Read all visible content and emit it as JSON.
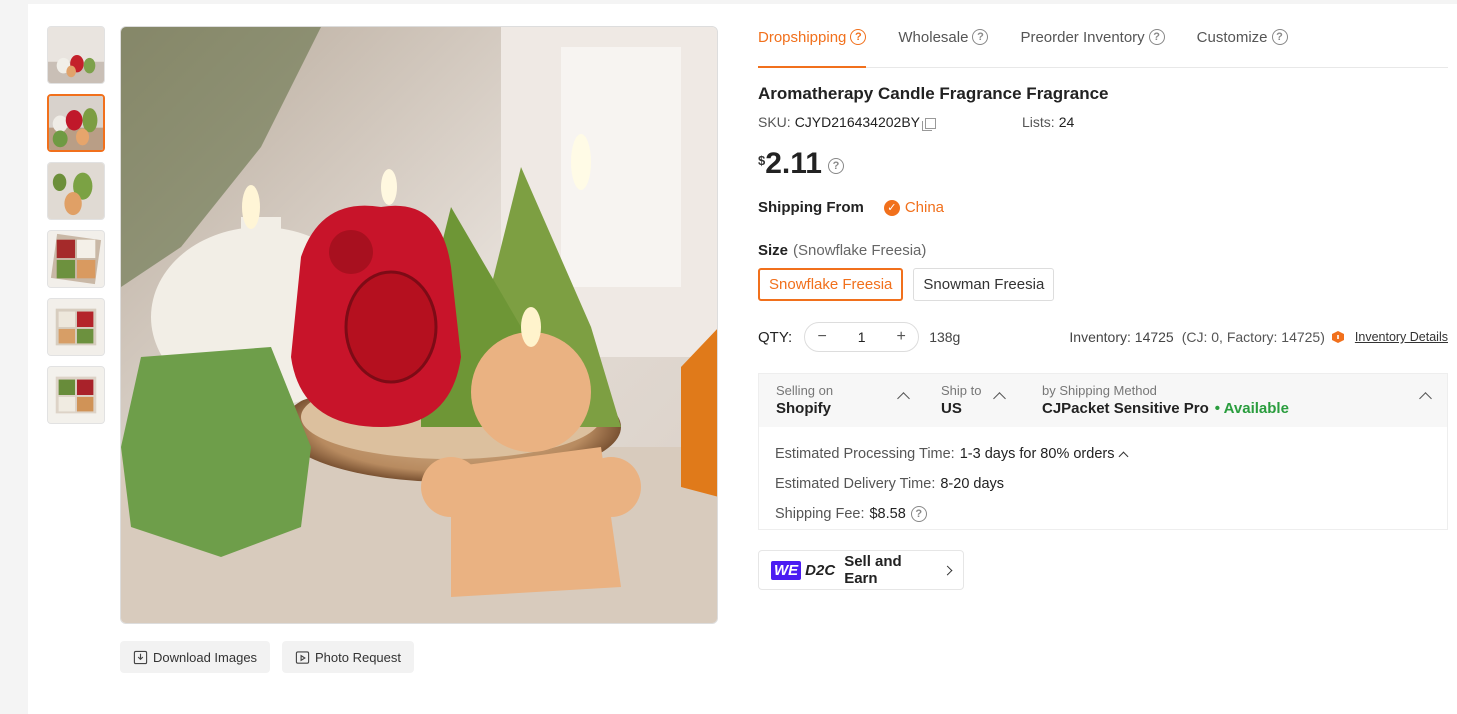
{
  "tabs": [
    {
      "label": "Dropshipping",
      "active": true
    },
    {
      "label": "Wholesale",
      "active": false
    },
    {
      "label": "Preorder Inventory",
      "active": false
    },
    {
      "label": "Customize",
      "active": false
    }
  ],
  "product": {
    "title": "Aromatherapy Candle Fragrance Fragrance",
    "sku_label": "SKU:",
    "sku": "CJYD216434202BY",
    "lists_label": "Lists:",
    "lists": "24",
    "currency": "$",
    "price": "2.11"
  },
  "shipping_from": {
    "label": "Shipping From",
    "country": "China"
  },
  "size": {
    "label": "Size",
    "selected": "(Snowflake Freesia)",
    "options": [
      "Snowflake Freesia",
      "Snowman Freesia"
    ]
  },
  "qty": {
    "label": "QTY:",
    "value": "1",
    "weight": "138g",
    "inventory": "Inventory: 14725",
    "inventory_breakdown": "(CJ: 0, Factory: 14725)",
    "inventory_link": "Inventory Details"
  },
  "shipping": {
    "selling_on_label": "Selling on",
    "selling_on": "Shopify",
    "ship_to_label": "Ship to",
    "ship_to": "US",
    "method_label": "by Shipping Method",
    "method": "CJPacket Sensitive Pro",
    "availability": "• Available",
    "processing_label": "Estimated Processing Time:",
    "processing": "1-3 days for 80% orders",
    "delivery_label": "Estimated Delivery Time:",
    "delivery": "8-20 days",
    "fee_label": "Shipping Fee:",
    "fee": "$8.58"
  },
  "promo": {
    "we": "WE",
    "d2c": "D2C",
    "label": "Sell and Earn"
  },
  "image_actions": {
    "download": "Download Images",
    "photo_request": "Photo Request"
  },
  "icons": {
    "help": "question-circle-icon",
    "copy": "copy-icon",
    "check": "check-circle-icon",
    "box": "box-icon",
    "download": "download-image-icon",
    "photo": "photo-frame-icon"
  },
  "colors": {
    "accent": "#f1701c",
    "available": "#2a9d3e",
    "we_brand": "#4b1cf2"
  }
}
